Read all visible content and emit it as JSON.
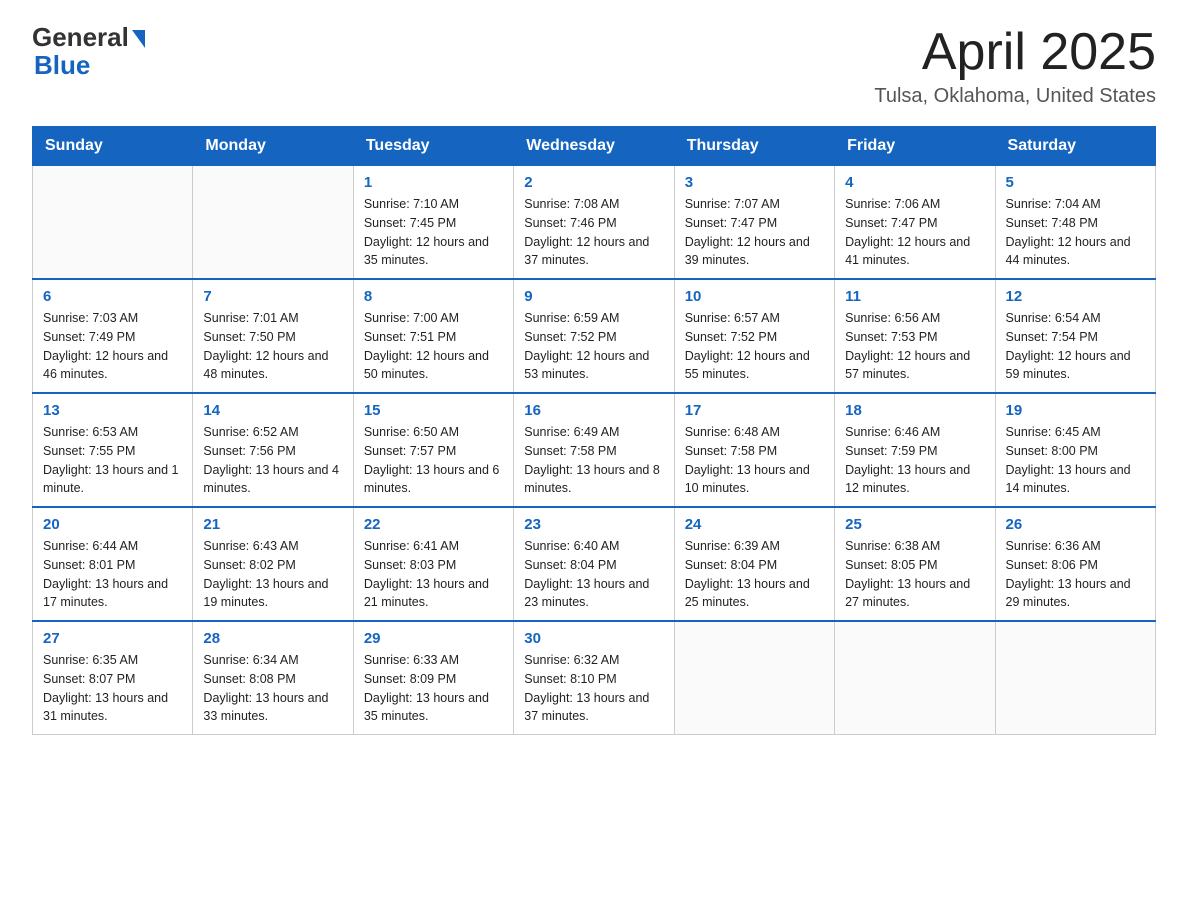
{
  "header": {
    "title": "April 2025",
    "subtitle": "Tulsa, Oklahoma, United States",
    "logo_general": "General",
    "logo_blue": "Blue"
  },
  "days_of_week": [
    "Sunday",
    "Monday",
    "Tuesday",
    "Wednesday",
    "Thursday",
    "Friday",
    "Saturday"
  ],
  "weeks": [
    [
      {
        "day": "",
        "sunrise": "",
        "sunset": "",
        "daylight": ""
      },
      {
        "day": "",
        "sunrise": "",
        "sunset": "",
        "daylight": ""
      },
      {
        "day": "1",
        "sunrise": "Sunrise: 7:10 AM",
        "sunset": "Sunset: 7:45 PM",
        "daylight": "Daylight: 12 hours and 35 minutes."
      },
      {
        "day": "2",
        "sunrise": "Sunrise: 7:08 AM",
        "sunset": "Sunset: 7:46 PM",
        "daylight": "Daylight: 12 hours and 37 minutes."
      },
      {
        "day": "3",
        "sunrise": "Sunrise: 7:07 AM",
        "sunset": "Sunset: 7:47 PM",
        "daylight": "Daylight: 12 hours and 39 minutes."
      },
      {
        "day": "4",
        "sunrise": "Sunrise: 7:06 AM",
        "sunset": "Sunset: 7:47 PM",
        "daylight": "Daylight: 12 hours and 41 minutes."
      },
      {
        "day": "5",
        "sunrise": "Sunrise: 7:04 AM",
        "sunset": "Sunset: 7:48 PM",
        "daylight": "Daylight: 12 hours and 44 minutes."
      }
    ],
    [
      {
        "day": "6",
        "sunrise": "Sunrise: 7:03 AM",
        "sunset": "Sunset: 7:49 PM",
        "daylight": "Daylight: 12 hours and 46 minutes."
      },
      {
        "day": "7",
        "sunrise": "Sunrise: 7:01 AM",
        "sunset": "Sunset: 7:50 PM",
        "daylight": "Daylight: 12 hours and 48 minutes."
      },
      {
        "day": "8",
        "sunrise": "Sunrise: 7:00 AM",
        "sunset": "Sunset: 7:51 PM",
        "daylight": "Daylight: 12 hours and 50 minutes."
      },
      {
        "day": "9",
        "sunrise": "Sunrise: 6:59 AM",
        "sunset": "Sunset: 7:52 PM",
        "daylight": "Daylight: 12 hours and 53 minutes."
      },
      {
        "day": "10",
        "sunrise": "Sunrise: 6:57 AM",
        "sunset": "Sunset: 7:52 PM",
        "daylight": "Daylight: 12 hours and 55 minutes."
      },
      {
        "day": "11",
        "sunrise": "Sunrise: 6:56 AM",
        "sunset": "Sunset: 7:53 PM",
        "daylight": "Daylight: 12 hours and 57 minutes."
      },
      {
        "day": "12",
        "sunrise": "Sunrise: 6:54 AM",
        "sunset": "Sunset: 7:54 PM",
        "daylight": "Daylight: 12 hours and 59 minutes."
      }
    ],
    [
      {
        "day": "13",
        "sunrise": "Sunrise: 6:53 AM",
        "sunset": "Sunset: 7:55 PM",
        "daylight": "Daylight: 13 hours and 1 minute."
      },
      {
        "day": "14",
        "sunrise": "Sunrise: 6:52 AM",
        "sunset": "Sunset: 7:56 PM",
        "daylight": "Daylight: 13 hours and 4 minutes."
      },
      {
        "day": "15",
        "sunrise": "Sunrise: 6:50 AM",
        "sunset": "Sunset: 7:57 PM",
        "daylight": "Daylight: 13 hours and 6 minutes."
      },
      {
        "day": "16",
        "sunrise": "Sunrise: 6:49 AM",
        "sunset": "Sunset: 7:58 PM",
        "daylight": "Daylight: 13 hours and 8 minutes."
      },
      {
        "day": "17",
        "sunrise": "Sunrise: 6:48 AM",
        "sunset": "Sunset: 7:58 PM",
        "daylight": "Daylight: 13 hours and 10 minutes."
      },
      {
        "day": "18",
        "sunrise": "Sunrise: 6:46 AM",
        "sunset": "Sunset: 7:59 PM",
        "daylight": "Daylight: 13 hours and 12 minutes."
      },
      {
        "day": "19",
        "sunrise": "Sunrise: 6:45 AM",
        "sunset": "Sunset: 8:00 PM",
        "daylight": "Daylight: 13 hours and 14 minutes."
      }
    ],
    [
      {
        "day": "20",
        "sunrise": "Sunrise: 6:44 AM",
        "sunset": "Sunset: 8:01 PM",
        "daylight": "Daylight: 13 hours and 17 minutes."
      },
      {
        "day": "21",
        "sunrise": "Sunrise: 6:43 AM",
        "sunset": "Sunset: 8:02 PM",
        "daylight": "Daylight: 13 hours and 19 minutes."
      },
      {
        "day": "22",
        "sunrise": "Sunrise: 6:41 AM",
        "sunset": "Sunset: 8:03 PM",
        "daylight": "Daylight: 13 hours and 21 minutes."
      },
      {
        "day": "23",
        "sunrise": "Sunrise: 6:40 AM",
        "sunset": "Sunset: 8:04 PM",
        "daylight": "Daylight: 13 hours and 23 minutes."
      },
      {
        "day": "24",
        "sunrise": "Sunrise: 6:39 AM",
        "sunset": "Sunset: 8:04 PM",
        "daylight": "Daylight: 13 hours and 25 minutes."
      },
      {
        "day": "25",
        "sunrise": "Sunrise: 6:38 AM",
        "sunset": "Sunset: 8:05 PM",
        "daylight": "Daylight: 13 hours and 27 minutes."
      },
      {
        "day": "26",
        "sunrise": "Sunrise: 6:36 AM",
        "sunset": "Sunset: 8:06 PM",
        "daylight": "Daylight: 13 hours and 29 minutes."
      }
    ],
    [
      {
        "day": "27",
        "sunrise": "Sunrise: 6:35 AM",
        "sunset": "Sunset: 8:07 PM",
        "daylight": "Daylight: 13 hours and 31 minutes."
      },
      {
        "day": "28",
        "sunrise": "Sunrise: 6:34 AM",
        "sunset": "Sunset: 8:08 PM",
        "daylight": "Daylight: 13 hours and 33 minutes."
      },
      {
        "day": "29",
        "sunrise": "Sunrise: 6:33 AM",
        "sunset": "Sunset: 8:09 PM",
        "daylight": "Daylight: 13 hours and 35 minutes."
      },
      {
        "day": "30",
        "sunrise": "Sunrise: 6:32 AM",
        "sunset": "Sunset: 8:10 PM",
        "daylight": "Daylight: 13 hours and 37 minutes."
      },
      {
        "day": "",
        "sunrise": "",
        "sunset": "",
        "daylight": ""
      },
      {
        "day": "",
        "sunrise": "",
        "sunset": "",
        "daylight": ""
      },
      {
        "day": "",
        "sunrise": "",
        "sunset": "",
        "daylight": ""
      }
    ]
  ]
}
